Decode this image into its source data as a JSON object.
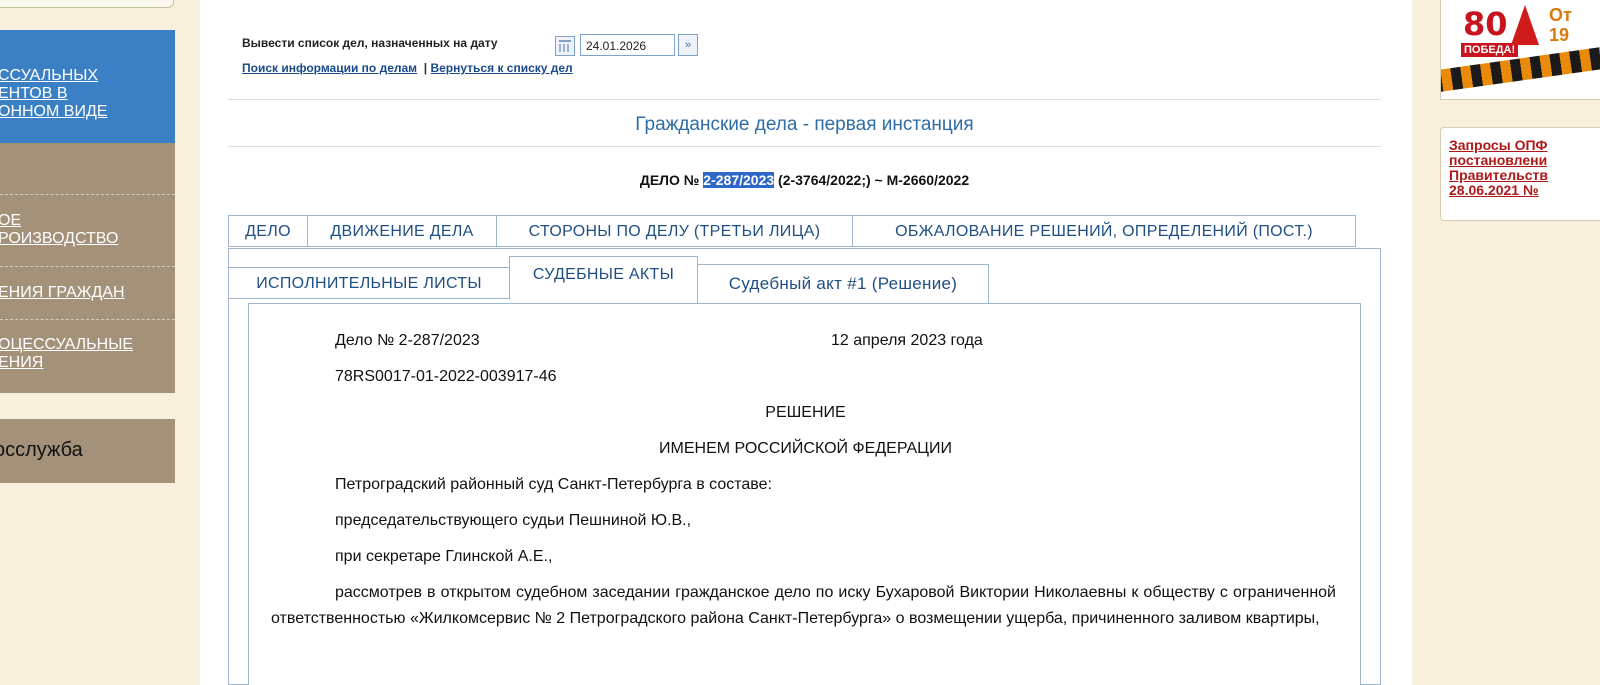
{
  "left_nav": {
    "blue_link": "ССУАЛЬНЫХ\nЕНТОВ В\nОННОМ ВИДЕ",
    "menu_items": [
      {
        "label": "ОЕ\nРОИЗВОДСТВО"
      },
      {
        "label": "ЕНИЯ ГРАЖДАН"
      },
      {
        "label": "ОЦЕССУАЛЬНЫЕ\nЕНИЯ"
      }
    ],
    "gos_label": "осслужба"
  },
  "header": {
    "date_prompt": "Вывести список дел, назначенных на дату",
    "date_value": "24.01.2026",
    "go_symbol": "»",
    "search_link": "Поиск информации по делам",
    "separator": "|",
    "back_link": "Вернуться к списку дел"
  },
  "section_title": "Гражданские дела - первая инстанция",
  "case": {
    "prefix": "ДЕЛО № ",
    "number": "2-287/2023",
    "suffix": " (2-3764/2022;) ~ М-2660/2022"
  },
  "tabs_row1": [
    "ДЕЛО",
    "ДВИЖЕНИЕ ДЕЛА",
    "СТОРОНЫ ПО ДЕЛУ (ТРЕТЬИ ЛИЦА)",
    "ОБЖАЛОВАНИЕ РЕШЕНИЙ, ОПРЕДЕЛЕНИЙ (ПОСТ.)"
  ],
  "tabs_row2": [
    "ИСПОЛНИТЕЛЬНЫЕ ЛИСТЫ",
    "СУДЕБНЫЕ АКТЫ"
  ],
  "subtab": "Судебный акт #1 (Решение)",
  "document": {
    "case_line": "Дело № 2-287/2023",
    "date": "12 апреля 2023 года",
    "uid": "78RS0017-01-2022-003917-46",
    "heading": "РЕШЕНИЕ",
    "subheading": "ИМЕНЕМ РОССИЙСКОЙ ФЕДЕРАЦИИ",
    "line1": "Петроградский районный суд Санкт-Петербурга в составе:",
    "line2": "председательствующего судьи Пешниной Ю.В.,",
    "line3": "при секретаре Глинской А.Е.,",
    "paragraph": "рассмотрев в открытом судебном заседании гражданское дело по иску Бухаровой Виктории Николаевны к обществу с ограниченной ответственностью «Жилкомсервис № 2 Петроградского района Санкт-Петербурга» о возмещении ущерба, причиненного заливом квартиры,"
  },
  "right": {
    "banner_number": "80",
    "banner_word": "ПОБЕДА!",
    "banner_text1": "От",
    "banner_text2": "19",
    "notice_link": "Запросы ОПФ\nпостановлени\nПравительств\n28.06.2021 №"
  }
}
